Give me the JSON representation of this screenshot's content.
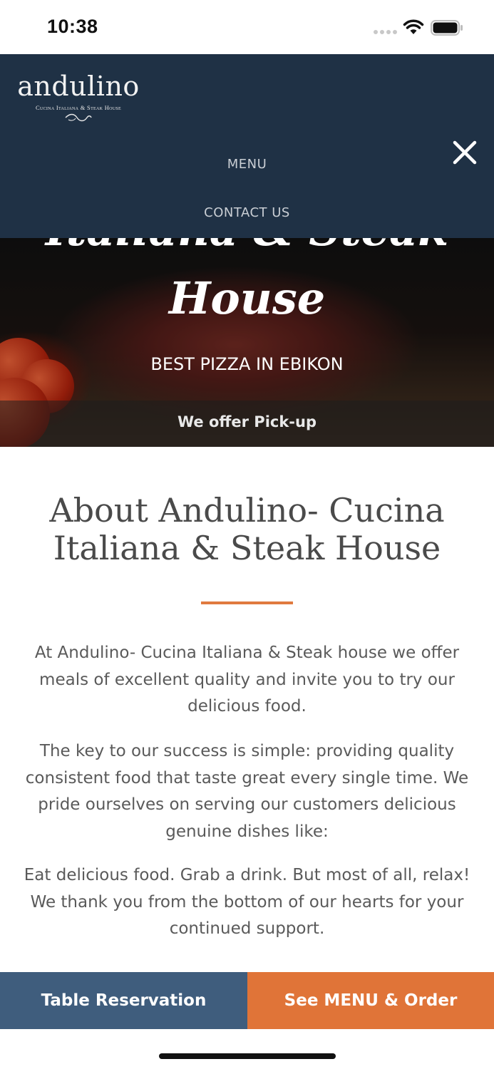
{
  "status_bar": {
    "time": "10:38"
  },
  "header": {
    "logo": {
      "wordmark": "andulino",
      "tagline": "Cucina Italiana & Steak House"
    },
    "nav_items": [
      "MENU",
      "CONTACT US"
    ]
  },
  "hero": {
    "title_partial": "Italiana & Steak",
    "title_house": "House",
    "subtitle": "BEST PIZZA IN EBIKON",
    "pickup": "We offer Pick-up"
  },
  "about": {
    "title": "About Andulino- Cucina Italiana & Steak House",
    "paragraphs": [
      "At Andulino- Cucina Italiana & Steak house we offer meals of excellent quality and invite you to try our delicious food.",
      "The key to our success is simple: providing quality consistent food that taste great every single time. We pride ourselves on serving our customers delicious genuine dishes like:",
      "Eat delicious food. Grab a drink. But most of all, relax! We thank you from the bottom of our hearts for your continued support."
    ]
  },
  "actions": {
    "reserve": "Table Reservation",
    "order": "See MENU & Order"
  },
  "colors": {
    "header_bg": "#1f3145",
    "accent_orange": "#e07438",
    "reserve_blue": "#3f5d7d"
  },
  "icons": [
    "signal-icon",
    "wifi-icon",
    "battery-icon",
    "close-icon"
  ]
}
